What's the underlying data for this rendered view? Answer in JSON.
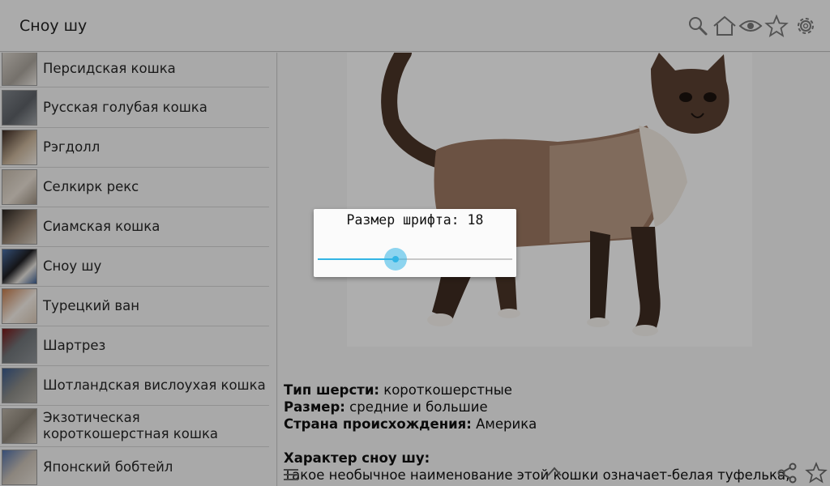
{
  "actionbar": {
    "title": "Сноу шу",
    "icons": [
      "search-icon",
      "home-icon",
      "eye-icon",
      "star-icon",
      "gear-icon"
    ]
  },
  "sidebar": {
    "items": [
      {
        "label": "Персидская кошка"
      },
      {
        "label": "Русская голубая кошка"
      },
      {
        "label": "Рэгдолл"
      },
      {
        "label": "Селкирк рекс"
      },
      {
        "label": "Сиамская кошка"
      },
      {
        "label": "Сноу шу"
      },
      {
        "label": "Турецкий ван"
      },
      {
        "label": "Шартрез"
      },
      {
        "label": "Шотландская вислоухая кошка"
      },
      {
        "label": "Экзотическая короткошерстная кошка"
      },
      {
        "label": "Японский бобтейл"
      }
    ]
  },
  "details": {
    "coat_label": "Тип шерсти:",
    "coat_value": " короткошерстные",
    "size_label": "Размер:",
    "size_value": " средние и большие",
    "origin_label": "Страна происхождения:",
    "origin_value": " Америка",
    "character_heading": "Характер сноу шу:",
    "character_text": "Такое необычное наименование этой кошки означает-белая туфелька,"
  },
  "dialog": {
    "title": "Размер шрифта: 18",
    "slider_fraction": 0.4
  },
  "colors": {
    "accent": "#33b5e5"
  }
}
